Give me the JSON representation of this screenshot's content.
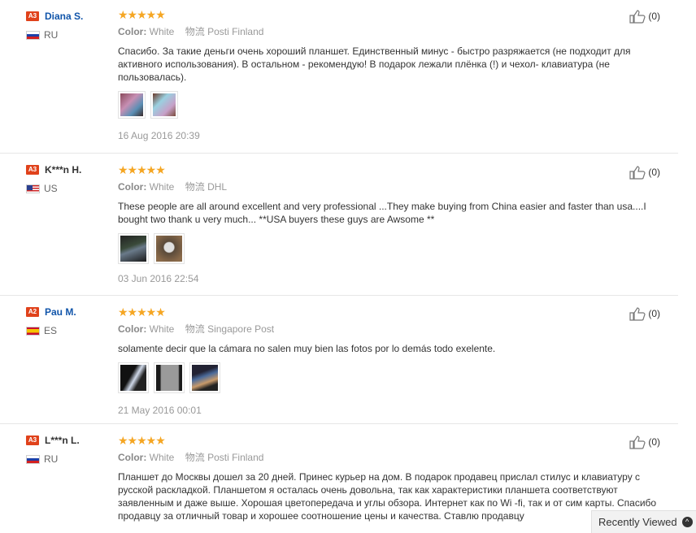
{
  "reviews": [
    {
      "level": "A3",
      "name": "Diana S.",
      "country": "RU",
      "flag": "ru",
      "stars": "★★★★★",
      "color_label": "Color:",
      "color_value": "White",
      "shipping_icon": "物流",
      "shipping_method": "Posti Finland",
      "text": "Спасибо. За такие деньги очень хороший планшет. Единственный минус - быстро разряжается (не подходит для активного использования). В остальном - рекомендую! В подарок лежали плёнка (!) и чехол- клавиатура (не пользовалась).",
      "photos": [
        "tablet-photo-pink",
        "tablet-photo-blue"
      ],
      "date": "16 Aug 2016 20:39",
      "helpful_count": "(0)"
    },
    {
      "level": "A3",
      "name": "K***n H.",
      "country": "US",
      "flag": "us",
      "stars": "★★★★★",
      "color_label": "Color:",
      "color_value": "White",
      "shipping_icon": "物流",
      "shipping_method": "DHL",
      "text": "These people are all around excellent and very professional ...They make buying from China easier and faster than usa....I bought two thank u very much... **USA buyers these guys are Awsome **",
      "photos": [
        "tablet-photo-dark",
        "tablet-photo-brown"
      ],
      "date": "03 Jun 2016 22:54",
      "helpful_count": "(0)"
    },
    {
      "level": "A2",
      "name": "Pau M.",
      "country": "ES",
      "flag": "es",
      "stars": "★★★★★",
      "color_label": "Color:",
      "color_value": "White",
      "shipping_icon": "物流",
      "shipping_method": "Singapore Post",
      "text": "solamente decir que la cámara no salen muy bien las fotos por lo demás todo exelente.",
      "photos": [
        "camera-photo-1",
        "camera-photo-2",
        "camera-photo-3"
      ],
      "date": "21 May 2016 00:01",
      "helpful_count": "(0)"
    },
    {
      "level": "A3",
      "name": "L***n L.",
      "country": "RU",
      "flag": "ru",
      "stars": "★★★★★",
      "color_label": "Color:",
      "color_value": "White",
      "shipping_icon": "物流",
      "shipping_method": "Posti Finland",
      "text": "Планшет до Москвы дошел за 20 дней. Принес курьер на дом. В подарок продавец прислал стилус и клавиатуру с русской раскладкой. Планшетом я осталась очень довольна, так как характеристики планшета соответствуют заявленным и даже выше. Хорошая цветопередача и углы обзора. Интернет как по Wi -fi, так и от сим карты. Спасибо продавцу за отличный товар и хорошее соотношение цены и качества. Ставлю продавцу",
      "photos": [],
      "date": "",
      "helpful_count": "(0)"
    }
  ],
  "recently_viewed": {
    "label": "Recently Viewed",
    "icon": "chevron-up-icon"
  },
  "colors": {
    "link": "#1155aa",
    "star": "#f5a623",
    "badge": "#e0421b"
  }
}
